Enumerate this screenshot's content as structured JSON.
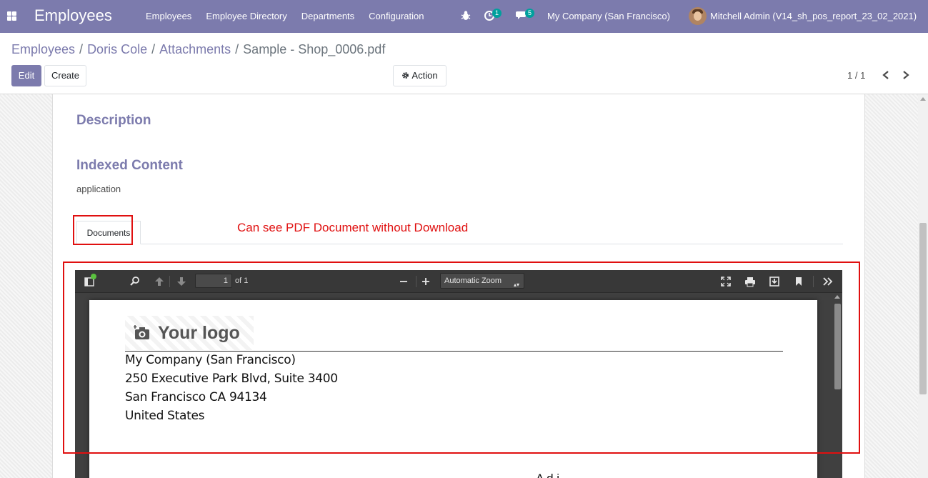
{
  "navbar": {
    "app_title": "Employees",
    "menu": [
      "Employees",
      "Employee Directory",
      "Departments",
      "Configuration"
    ],
    "activity_count": "1",
    "message_count": "5",
    "company": "My Company (San Francisco)",
    "user": "Mitchell Admin (V14_sh_pos_report_23_02_2021)",
    "accent_color": "#7c7bad"
  },
  "breadcrumb": {
    "items": [
      "Employees",
      "Doris Cole",
      "Attachments"
    ],
    "current": "Sample - Shop_0006.pdf"
  },
  "buttons": {
    "edit": "Edit",
    "create": "Create",
    "action": "Action"
  },
  "pager": {
    "value": "1 / 1"
  },
  "form": {
    "description_label": "Description",
    "indexed_label": "Indexed Content",
    "indexed_value": "application",
    "tab_label": "Documents"
  },
  "annotation": {
    "text": "Can see PDF Document without Download",
    "color": "#e01010"
  },
  "pdf": {
    "page_number": "1",
    "page_count_text": "of 1",
    "zoom": "Automatic Zoom",
    "logo_text": "Your logo",
    "address_lines": [
      "My Company (San Francisco)",
      "250 Executive Park Blvd, Suite 3400",
      "San Francisco CA 94134",
      "United States"
    ],
    "partial_text": "A d i"
  }
}
